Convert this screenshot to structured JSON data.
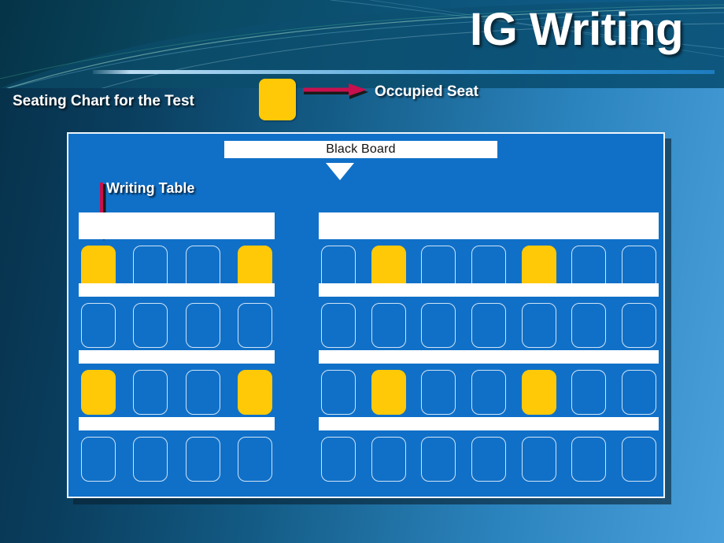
{
  "slide": {
    "title": "IG Writing",
    "chart_label": "Seating Chart for the Test"
  },
  "legend": {
    "swatch_color": "#FFC907",
    "arrow_color": "#C8104E",
    "label": "Occupied Seat"
  },
  "classroom": {
    "panel_color": "#1070c8",
    "blackboard_label": "Black Board",
    "writing_table_label": "Writing Table",
    "seat_empty_color": "#1070c8",
    "seat_occupied_color": "#FFC907",
    "rows": [
      {
        "name": "row-1",
        "has_table_bar": true,
        "left_group": [
          "occupied",
          "empty",
          "empty",
          "occupied"
        ],
        "right_group": [
          "empty",
          "occupied",
          "empty",
          "empty",
          "occupied",
          "empty",
          "empty"
        ]
      },
      {
        "name": "row-2",
        "has_table_bar": false,
        "left_group": [
          "empty",
          "empty",
          "empty",
          "empty"
        ],
        "right_group": [
          "empty",
          "empty",
          "empty",
          "empty",
          "empty",
          "empty",
          "empty"
        ]
      },
      {
        "name": "row-3",
        "has_table_bar": false,
        "left_group": [
          "occupied",
          "empty",
          "empty",
          "occupied"
        ],
        "right_group": [
          "empty",
          "occupied",
          "empty",
          "empty",
          "occupied",
          "empty",
          "empty"
        ]
      },
      {
        "name": "row-4",
        "has_table_bar": false,
        "left_group": [
          "empty",
          "empty",
          "empty",
          "empty"
        ],
        "right_group": [
          "empty",
          "empty",
          "empty",
          "empty",
          "empty",
          "empty",
          "empty"
        ]
      }
    ]
  }
}
